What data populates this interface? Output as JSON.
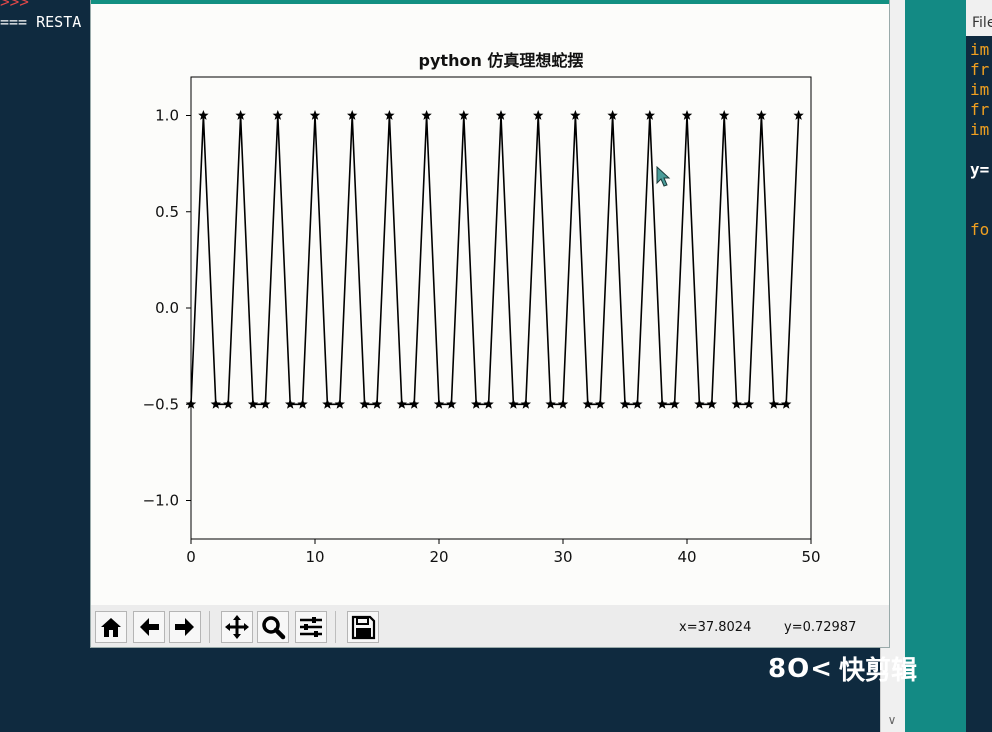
{
  "terminal": {
    "prompt": ">>>",
    "restart_text": "=== RESTA"
  },
  "editor": {
    "menu_label": "File",
    "code_lines": [
      {
        "text": "im",
        "color": "#f0a020"
      },
      {
        "text": "fr",
        "color": "#f0a020"
      },
      {
        "text": "im",
        "color": "#f0a020"
      },
      {
        "text": "fr",
        "color": "#f0a020"
      },
      {
        "text": "im",
        "color": "#f0a020"
      },
      {
        "text": "y=",
        "color": "#ffffff"
      },
      {
        "text": "fo",
        "color": "#f0a020"
      }
    ]
  },
  "toolbar": {
    "buttons": [
      {
        "name": "home-button",
        "icon": "home-icon"
      },
      {
        "name": "back-button",
        "icon": "arrow-left-icon"
      },
      {
        "name": "forward-button",
        "icon": "arrow-right-icon"
      },
      {
        "name": "pan-button",
        "icon": "move-icon"
      },
      {
        "name": "zoom-button",
        "icon": "zoom-icon"
      },
      {
        "name": "configure-subplots-button",
        "icon": "sliders-icon"
      },
      {
        "name": "save-button",
        "icon": "save-icon"
      }
    ],
    "coord_x": "x=37.8024",
    "coord_y": "y=0.72987"
  },
  "watermark": {
    "logo": "8O<",
    "text": "快剪辑"
  },
  "chart_data": {
    "type": "line",
    "title": "python 仿真理想蛇摆",
    "xlabel": "",
    "ylabel": "",
    "xlim": [
      0,
      50
    ],
    "ylim": [
      -1.2,
      1.2
    ],
    "xticks": [
      0,
      10,
      20,
      30,
      40,
      50
    ],
    "yticks": [
      1.0,
      0.5,
      0.0,
      -0.5,
      -1.0
    ],
    "ytick_labels": [
      "1.0",
      "0.5",
      "0.0",
      "−0.5",
      "−1.0"
    ],
    "marker": "star",
    "color": "#000000",
    "grid": false,
    "x": [
      0,
      1,
      2,
      3,
      4,
      5,
      6,
      7,
      8,
      9,
      10,
      11,
      12,
      13,
      14,
      15,
      16,
      17,
      18,
      19,
      20,
      21,
      22,
      23,
      24,
      25,
      26,
      27,
      28,
      29,
      30,
      31,
      32,
      33,
      34,
      35,
      36,
      37,
      38,
      39,
      40,
      41,
      42,
      43,
      44,
      45,
      46,
      47,
      48,
      49
    ],
    "y": [
      -0.5,
      1,
      -0.5,
      -0.5,
      1,
      -0.5,
      -0.5,
      1,
      -0.5,
      -0.5,
      1,
      -0.5,
      -0.5,
      1,
      -0.5,
      -0.5,
      1,
      -0.5,
      -0.5,
      1,
      -0.5,
      -0.5,
      1,
      -0.5,
      -0.5,
      1,
      -0.5,
      -0.5,
      1,
      -0.5,
      -0.5,
      1,
      -0.5,
      -0.5,
      1,
      -0.5,
      -0.5,
      1,
      -0.5,
      -0.5,
      1,
      -0.5,
      -0.5,
      1,
      -0.5,
      -0.5,
      1,
      -0.5,
      -0.5,
      1
    ]
  }
}
